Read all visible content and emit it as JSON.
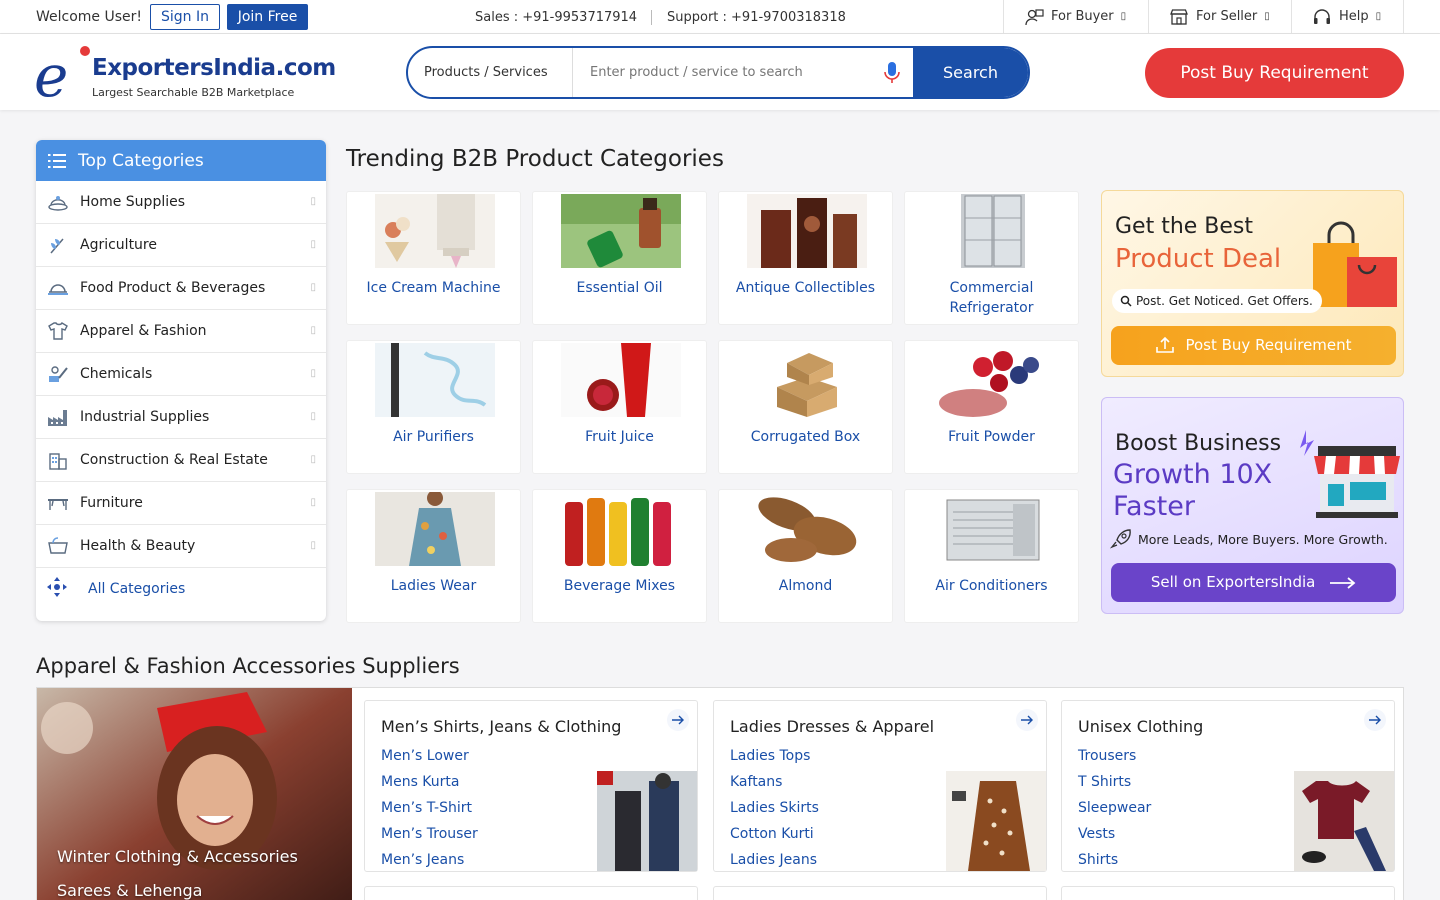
{
  "topbar": {
    "welcome": "Welcome User!",
    "signin": "Sign In",
    "join": "Join Free",
    "sales": "Sales : +91-9953717914",
    "support": "Support : +91-9700318318",
    "nav": [
      "For Buyer",
      "For Seller",
      "Help"
    ],
    "caret": "▯"
  },
  "header": {
    "logo_letter": "e",
    "logo_name": "ExportersIndia.com",
    "logo_tagline": "Largest Searchable B2B Marketplace",
    "search_category": "Products / Services",
    "search_placeholder": "Enter product / service to search",
    "search_button": "Search",
    "post_button": "Post Buy Requirement"
  },
  "top_categories": {
    "title": "Top Categories",
    "items": [
      {
        "label": "Home Supplies",
        "icon": "home-supplies-icon"
      },
      {
        "label": "Agriculture",
        "icon": "agriculture-icon"
      },
      {
        "label": "Food Product & Beverages",
        "icon": "food-icon"
      },
      {
        "label": "Apparel & Fashion",
        "icon": "tshirt-icon"
      },
      {
        "label": "Chemicals",
        "icon": "chemicals-icon"
      },
      {
        "label": "Industrial Supplies",
        "icon": "factory-icon"
      },
      {
        "label": "Construction & Real Estate",
        "icon": "building-icon"
      },
      {
        "label": "Furniture",
        "icon": "furniture-icon"
      },
      {
        "label": "Health & Beauty",
        "icon": "health-icon"
      }
    ],
    "arrow": "▯",
    "all_label": "All Categories"
  },
  "trending": {
    "title": "Trending B2B Product Categories",
    "tiles": [
      "Ice Cream Machine",
      "Essential Oil",
      "Antique Collectibles",
      "Commercial Refrigerator",
      "Air Purifiers",
      "Fruit Juice",
      "Corrugated Box",
      "Fruit Powder",
      "Ladies Wear",
      "Beverage Mixes",
      "Almond",
      "Air Conditioners"
    ]
  },
  "promo_deal": {
    "line1": "Get the Best",
    "line2": "Product Deal",
    "pill": "Post. Get Noticed. Get Offers.",
    "button": "Post Buy Requirement"
  },
  "promo_boost": {
    "line1": "Boost Business",
    "line2": "Growth 10X Faster",
    "sub": "More Leads, More Buyers. More Growth.",
    "button": "Sell on ExportersIndia"
  },
  "apparel": {
    "title": "Apparel & Fashion Accessories Suppliers",
    "hero_links": [
      "Winter Clothing & Accessories",
      "Sarees & Lehenga"
    ],
    "cards": [
      {
        "title": "Men’s Shirts, Jeans & Clothing",
        "items": [
          "Men’s Lower",
          "Mens Kurta",
          "Men’s T-Shirt",
          "Men’s Trouser",
          "Men’s Jeans"
        ]
      },
      {
        "title": "Ladies Dresses & Apparel",
        "items": [
          "Ladies Tops",
          "Kaftans",
          "Ladies Skirts",
          "Cotton Kurti",
          "Ladies Jeans"
        ]
      },
      {
        "title": "Unisex Clothing",
        "items": [
          "Trousers",
          "T Shirts",
          "Sleepwear",
          "Vests",
          "Shirts"
        ]
      }
    ]
  },
  "colors": {
    "brand_blue": "#1a4fa8",
    "accent_red": "#e53a3a",
    "category_header": "#4a90e2",
    "deal_orange": "#e8643a",
    "boost_purple": "#5b3bc4"
  }
}
